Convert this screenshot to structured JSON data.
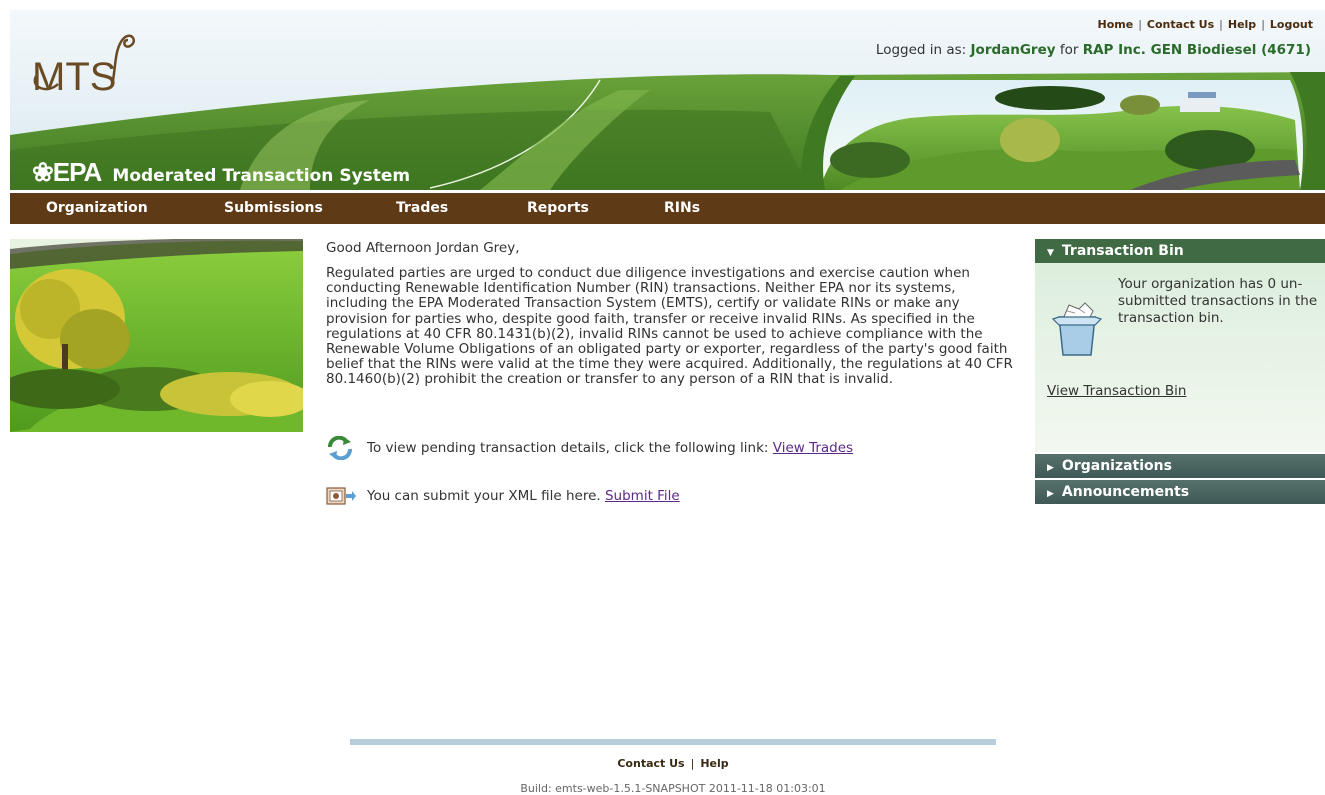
{
  "header": {
    "top_links": [
      "Home",
      "Contact Us",
      "Help",
      "Logout"
    ],
    "logged_in_prefix": "Logged in as:",
    "username": "JordanGrey",
    "for_word": "for",
    "organization": "RAP Inc. GEN Biodiesel (4671)",
    "logo_text": "MTS",
    "epa_text": "EPA",
    "system_name": "Moderated Transaction System"
  },
  "nav": [
    "Organization",
    "Submissions",
    "Trades",
    "Reports",
    "RINs"
  ],
  "main": {
    "greeting": "Good Afternoon Jordan Grey,",
    "notice": "Regulated parties are urged to conduct due diligence investigations and exercise caution when conducting Renewable Identification Number (RIN) transactions. Neither EPA nor its systems, including the EPA Moderated Transaction System (EMTS), certify or validate RINs or make any provision for parties who, despite good faith, transfer or receive invalid RINs. As specified in the regulations at 40 CFR 80.1431(b)(2), invalid RINs cannot be used to achieve compliance with the Renewable Volume Obligations of an obligated party or exporter, regardless of the party's good faith belief that the RINs were valid at the time they were acquired. Additionally, the regulations at 40 CFR 80.1460(b)(2) prohibit the creation or transfer to any person of a RIN that is invalid.",
    "trades_text": "To view pending transaction details, click the following link:",
    "trades_link": "View Trades",
    "submit_text": "You can submit your XML file here.",
    "submit_link": "Submit File"
  },
  "sidebar": {
    "bin_title": "Transaction Bin",
    "bin_message": "Your organization has 0 un-submitted transactions in the transaction bin.",
    "bin_link": "View Transaction Bin",
    "organizations_title": "Organizations",
    "announcements_title": "Announcements"
  },
  "footer": {
    "links": [
      "Contact Us",
      "Help"
    ],
    "build": "Build: emts-web-1.5.1-SNAPSHOT 2011-11-18 01:03:01"
  },
  "colors": {
    "nav_bg": "#5e3a16",
    "header_green": "#4f8a2a",
    "panel_green": "#3f6a43",
    "panel_slate": "#4a6662",
    "link": "#5b2a86"
  }
}
